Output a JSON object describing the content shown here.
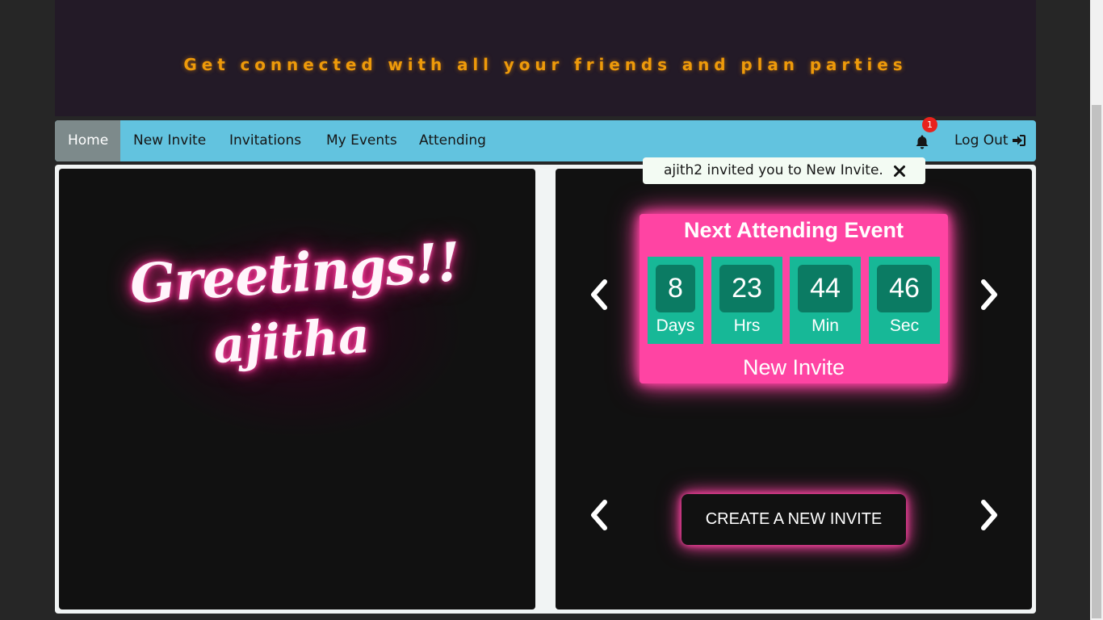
{
  "banner": {
    "tagline": "Get connected with all your friends and plan parties"
  },
  "nav": {
    "items": [
      {
        "label": "Home",
        "active": true
      },
      {
        "label": "New Invite"
      },
      {
        "label": "Invitations"
      },
      {
        "label": "My Events"
      },
      {
        "label": "Attending"
      }
    ],
    "notification_count": "1",
    "logout_label": "Log Out"
  },
  "toast": {
    "message": "ajith2 invited you to New Invite."
  },
  "greeting": {
    "line1": "Greetings!!",
    "line2": "ajitha"
  },
  "event": {
    "title": "Next Attending Event",
    "countdown": [
      {
        "value": "8",
        "label": "Days"
      },
      {
        "value": "23",
        "label": "Hrs"
      },
      {
        "value": "44",
        "label": "Min"
      },
      {
        "value": "46",
        "label": "Sec"
      }
    ],
    "name": "New Invite"
  },
  "create_button_label": "CREATE A NEW INVITE",
  "colors": {
    "accent_pink": "#ff44a3",
    "countdown_green": "#17b897",
    "navbar_blue": "#62c3df",
    "tagline_orange": "#ee9a0a"
  }
}
